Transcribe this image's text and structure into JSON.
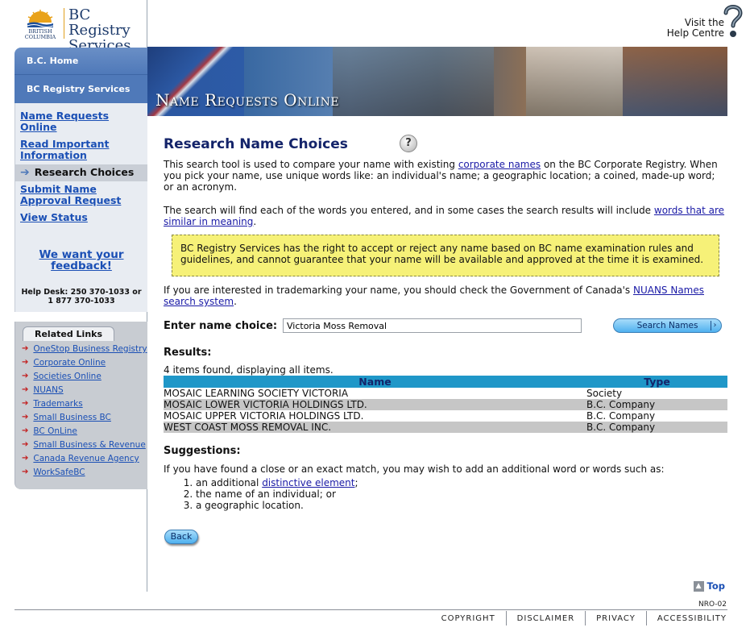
{
  "header": {
    "brand_line1": "BC Registry",
    "brand_line2": "Services",
    "province_line1": "BRITISH",
    "province_line2": "COLUMBIA",
    "help_line1": "Visit the",
    "help_line2": "Help Centre"
  },
  "banner": {
    "title": "Name Requests Online"
  },
  "sidebar": {
    "top_items": [
      "B.C. Home",
      "BC Registry Services"
    ],
    "nav_items": [
      "Name Requests Online",
      "Read Important Information",
      "Research Choices",
      "Submit Name Approval Request",
      "View Status"
    ],
    "active_item": "Research Choices",
    "feedback": "We want your feedback!",
    "helpdesk_line1": "Help Desk: 250 370-1033 or",
    "helpdesk_line2": "1 877 370-1033",
    "related_title": "Related Links",
    "related_links": [
      "OneStop Business Registry",
      "Corporate Online",
      "Societies Online",
      "NUANS",
      "Trademarks",
      "Small Business BC",
      "BC OnLine",
      "Small Business & Revenue",
      "Canada Revenue Agency",
      "WorkSafeBC"
    ]
  },
  "main": {
    "title": "Research Name Choices",
    "p1_a": "This search tool is used to compare your name with existing ",
    "p1_link": "corporate names",
    "p1_b": " on the BC Corporate Registry. When you pick your name, use unique words like: an individual's name; a geographic location; a coined, made-up word; or an acronym.",
    "p2_a": "The search will find each of the words you entered, and in some cases the search results will include ",
    "p2_link": "words that are similar in meaning",
    "p2_b": ".",
    "notice": "BC Registry Services has the right to accept or reject any name based on BC name examination rules and guidelines, and cannot guarantee that your name will be available and approved at the time it is examined.",
    "p3_a": "If you are interested in trademarking your name, you should check the Government of Canada's ",
    "p3_link": "NUANS Names search system",
    "p3_b": ".",
    "name_label": "Enter name choice:",
    "name_value": "Victoria Moss Removal",
    "search_button": "Search Names",
    "results_heading": "Results:",
    "results_count": "4 items found, displaying all items.",
    "columns": [
      "Name",
      "Type"
    ],
    "rows": [
      {
        "name": "MOSAIC LEARNING SOCIETY VICTORIA",
        "type": "Society"
      },
      {
        "name": "MOSAIC LOWER VICTORIA HOLDINGS LTD.",
        "type": "B.C. Company"
      },
      {
        "name": "MOSAIC UPPER VICTORIA HOLDINGS LTD.",
        "type": "B.C. Company"
      },
      {
        "name": "WEST COAST MOSS REMOVAL INC.",
        "type": "B.C. Company"
      }
    ],
    "suggestions_heading": "Suggestions:",
    "suggestions_text": "If you have found a close or an exact match, you may wish to add an additional word or words such as:",
    "sugg1_a": "an additional ",
    "sugg1_link": "distinctive element",
    "sugg1_b": ";",
    "sugg2": "the name of an individual; or",
    "sugg3": "a geographic location.",
    "back_button": "Back"
  },
  "footer": {
    "top": "Top",
    "page_code": "NRO-02",
    "links": [
      "COPYRIGHT",
      "DISCLAIMER",
      "PRIVACY",
      "ACCESSIBILITY"
    ]
  }
}
